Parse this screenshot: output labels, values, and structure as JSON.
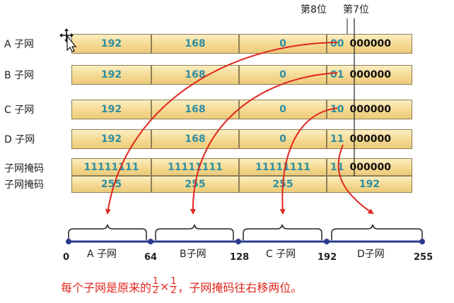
{
  "bit_labels": {
    "bit8": "第8位",
    "bit7": "第7位"
  },
  "rows": [
    {
      "label": "A 子网",
      "octets": [
        "192",
        "168",
        "0"
      ],
      "bits": "00",
      "zeros": "000000"
    },
    {
      "label": "B 子网",
      "octets": [
        "192",
        "168",
        "0"
      ],
      "bits": "01",
      "zeros": "000000"
    },
    {
      "label": "C 子网",
      "octets": [
        "192",
        "168",
        "0"
      ],
      "bits": "10",
      "zeros": "000000"
    },
    {
      "label": "D 子网",
      "octets": [
        "192",
        "168",
        "0"
      ],
      "bits": "11",
      "zeros": "000000"
    }
  ],
  "mask_binary": {
    "label": "子网掩码",
    "octets": [
      "11111111",
      "11111111",
      "11111111"
    ],
    "bits": "11",
    "zeros": "000000"
  },
  "mask_decimal": {
    "label": "子网掩码",
    "octets": [
      "255",
      "255",
      "255",
      "192"
    ]
  },
  "number_line": {
    "ticks": [
      "0",
      "64",
      "128",
      "192",
      "255"
    ],
    "segments": [
      "A 子网",
      "B子网",
      "C 子网",
      "D子网"
    ]
  },
  "note": {
    "prefix": "每个子网是原来的",
    "frac_num": "1",
    "frac_den": "2",
    "times": "×",
    "suffix": "，子网掩码往右移两位。"
  },
  "colors": {
    "arrow": "#e0261e",
    "line": "#2b3990",
    "cell_text": "#2e8ea3"
  }
}
